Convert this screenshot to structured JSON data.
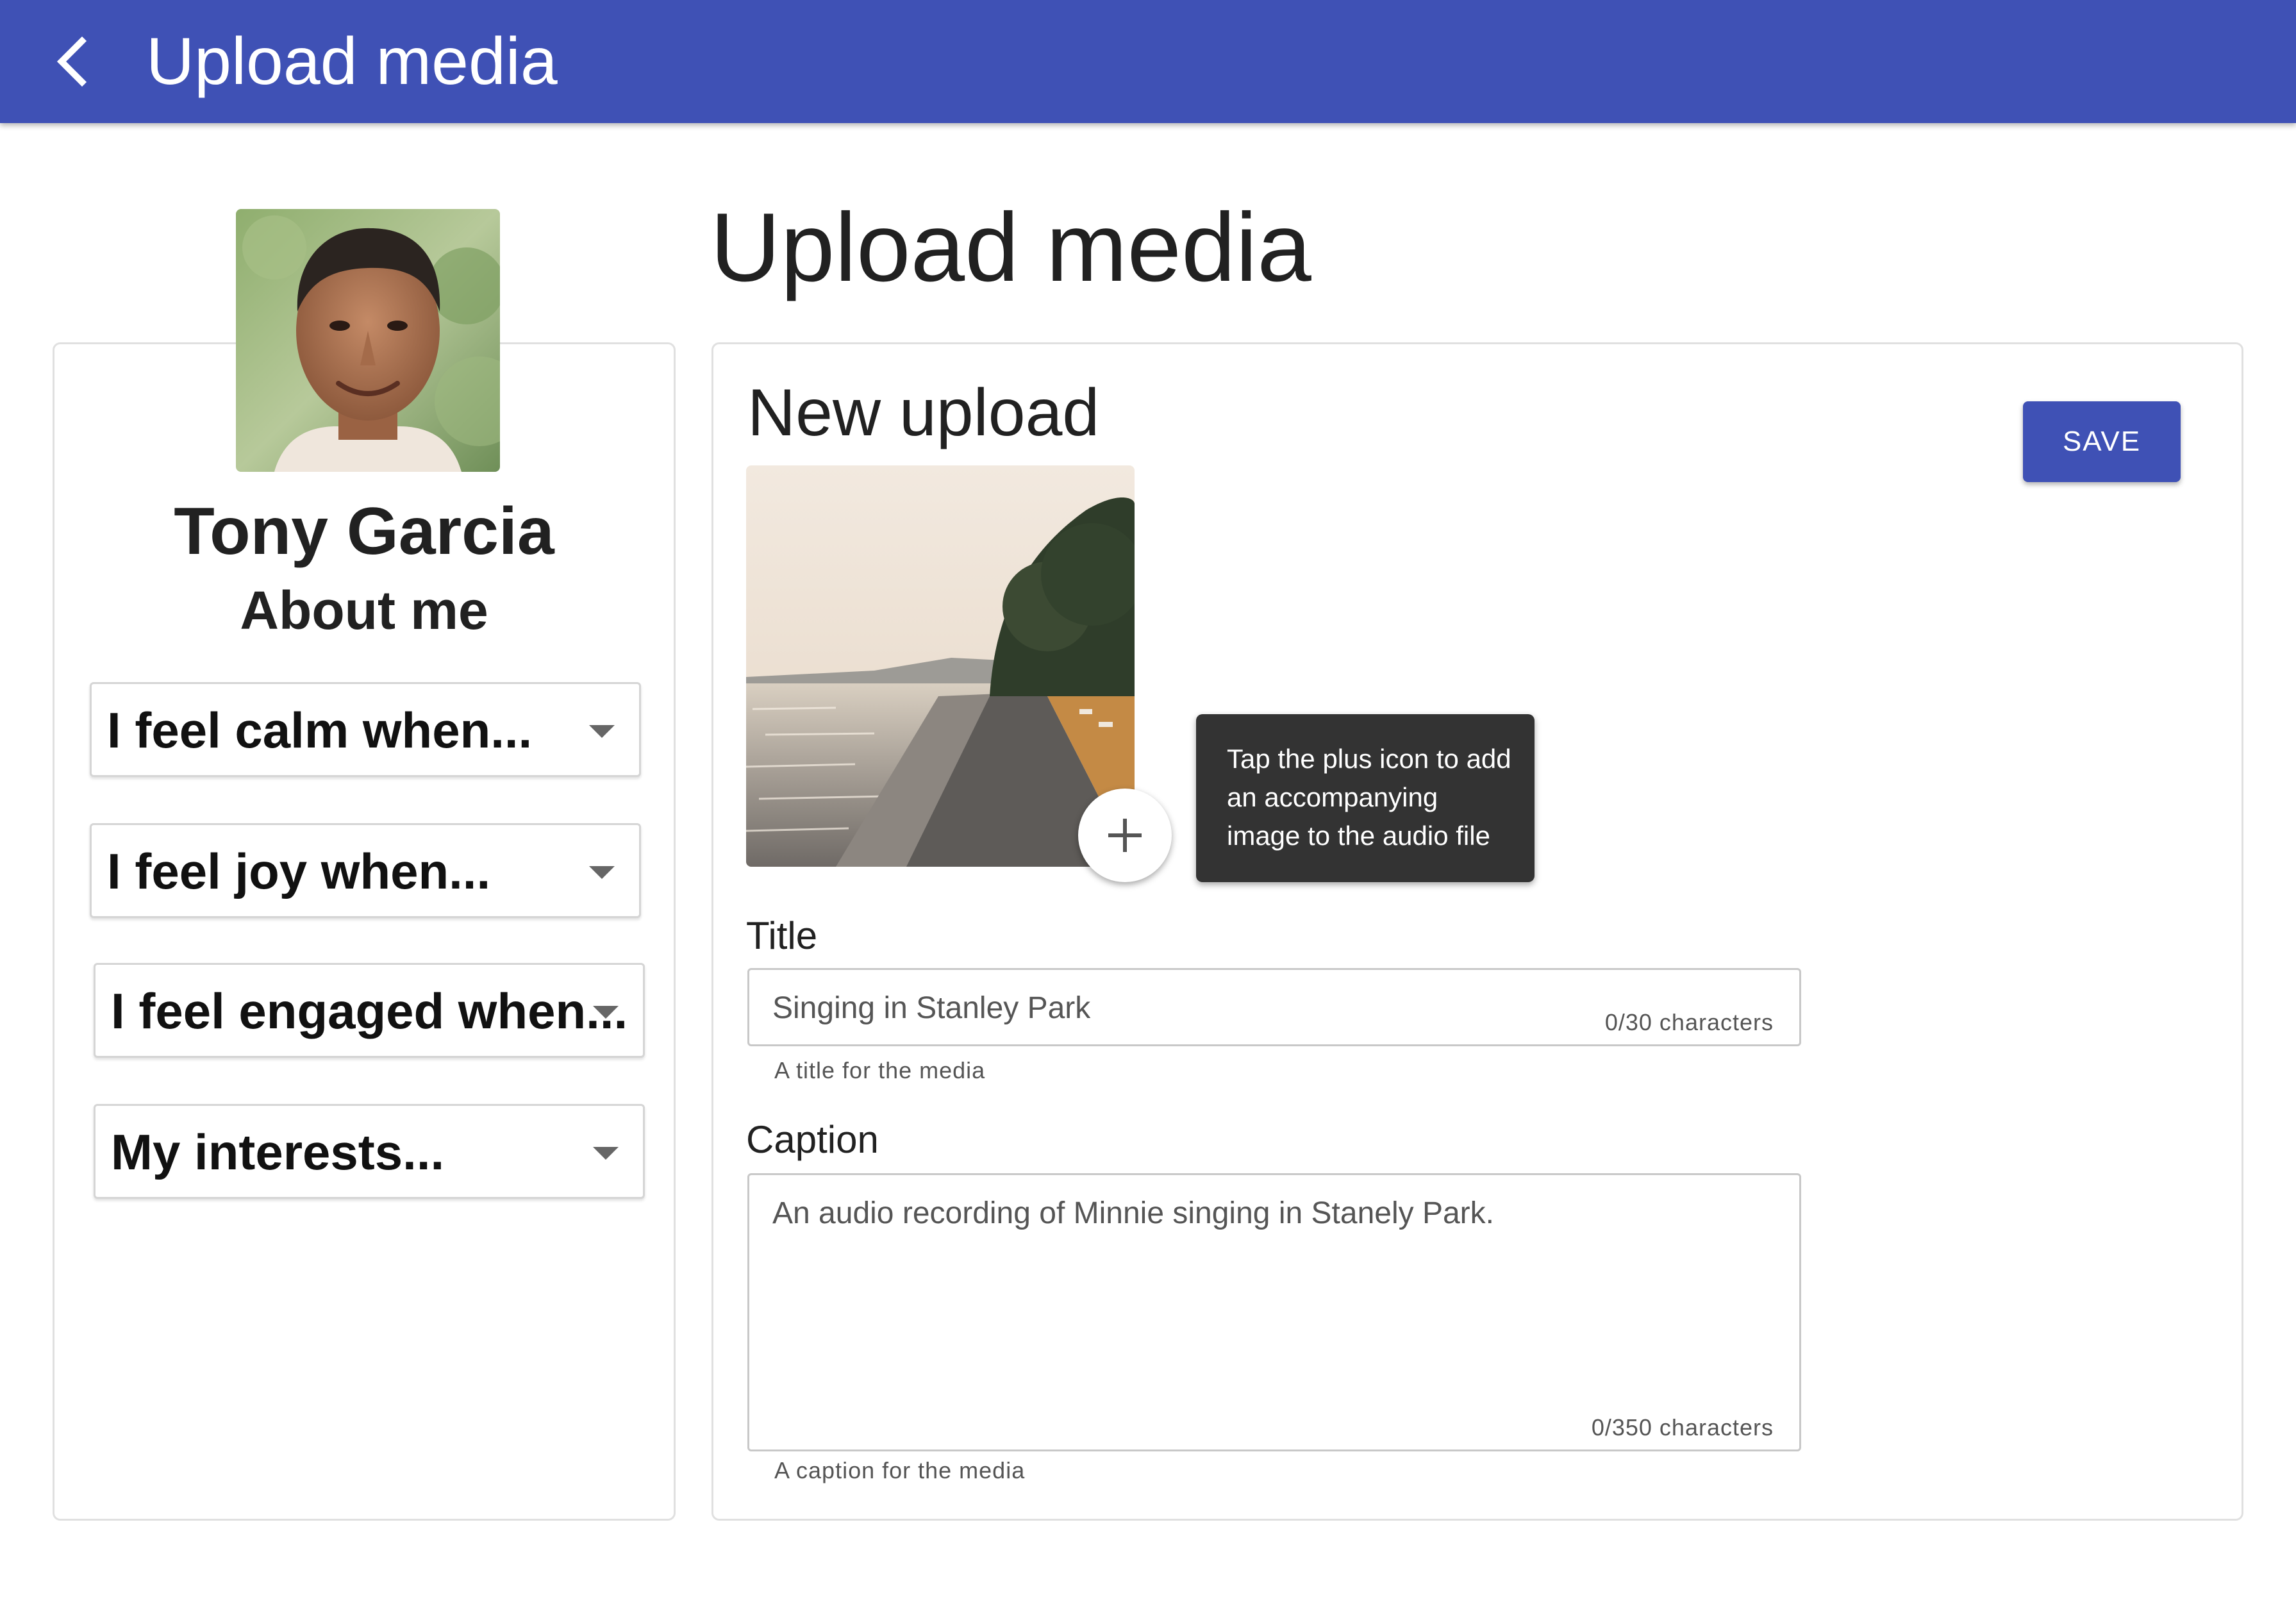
{
  "app_bar": {
    "title": "Upload media",
    "background": "#3f51b5",
    "back_icon": "chevron-left-icon"
  },
  "profile": {
    "name": "Tony Garcia",
    "about_heading": "About me",
    "dropdowns": [
      {
        "label": "I feel calm when..."
      },
      {
        "label": "I feel joy when..."
      },
      {
        "label": "I feel engaged when..."
      },
      {
        "label": "My interests..."
      }
    ]
  },
  "main": {
    "page_title": "Upload media",
    "card_title": "New upload",
    "save_label": "SAVE",
    "add_icon": "plus-icon",
    "tooltip": "Tap the plus icon to add an accompanying image to the audio file",
    "title_field": {
      "label": "Title",
      "value": "Singing in Stanley Park",
      "counter": "0/30 characters",
      "helper": "A title for the media"
    },
    "caption_field": {
      "label": "Caption",
      "value": "An audio recording of Minnie singing in Stanely Park.",
      "counter": "0/350 characters",
      "helper": "A caption for the media"
    }
  },
  "colors": {
    "accent": "#3f51b5",
    "tooltip_bg": "#333333"
  }
}
